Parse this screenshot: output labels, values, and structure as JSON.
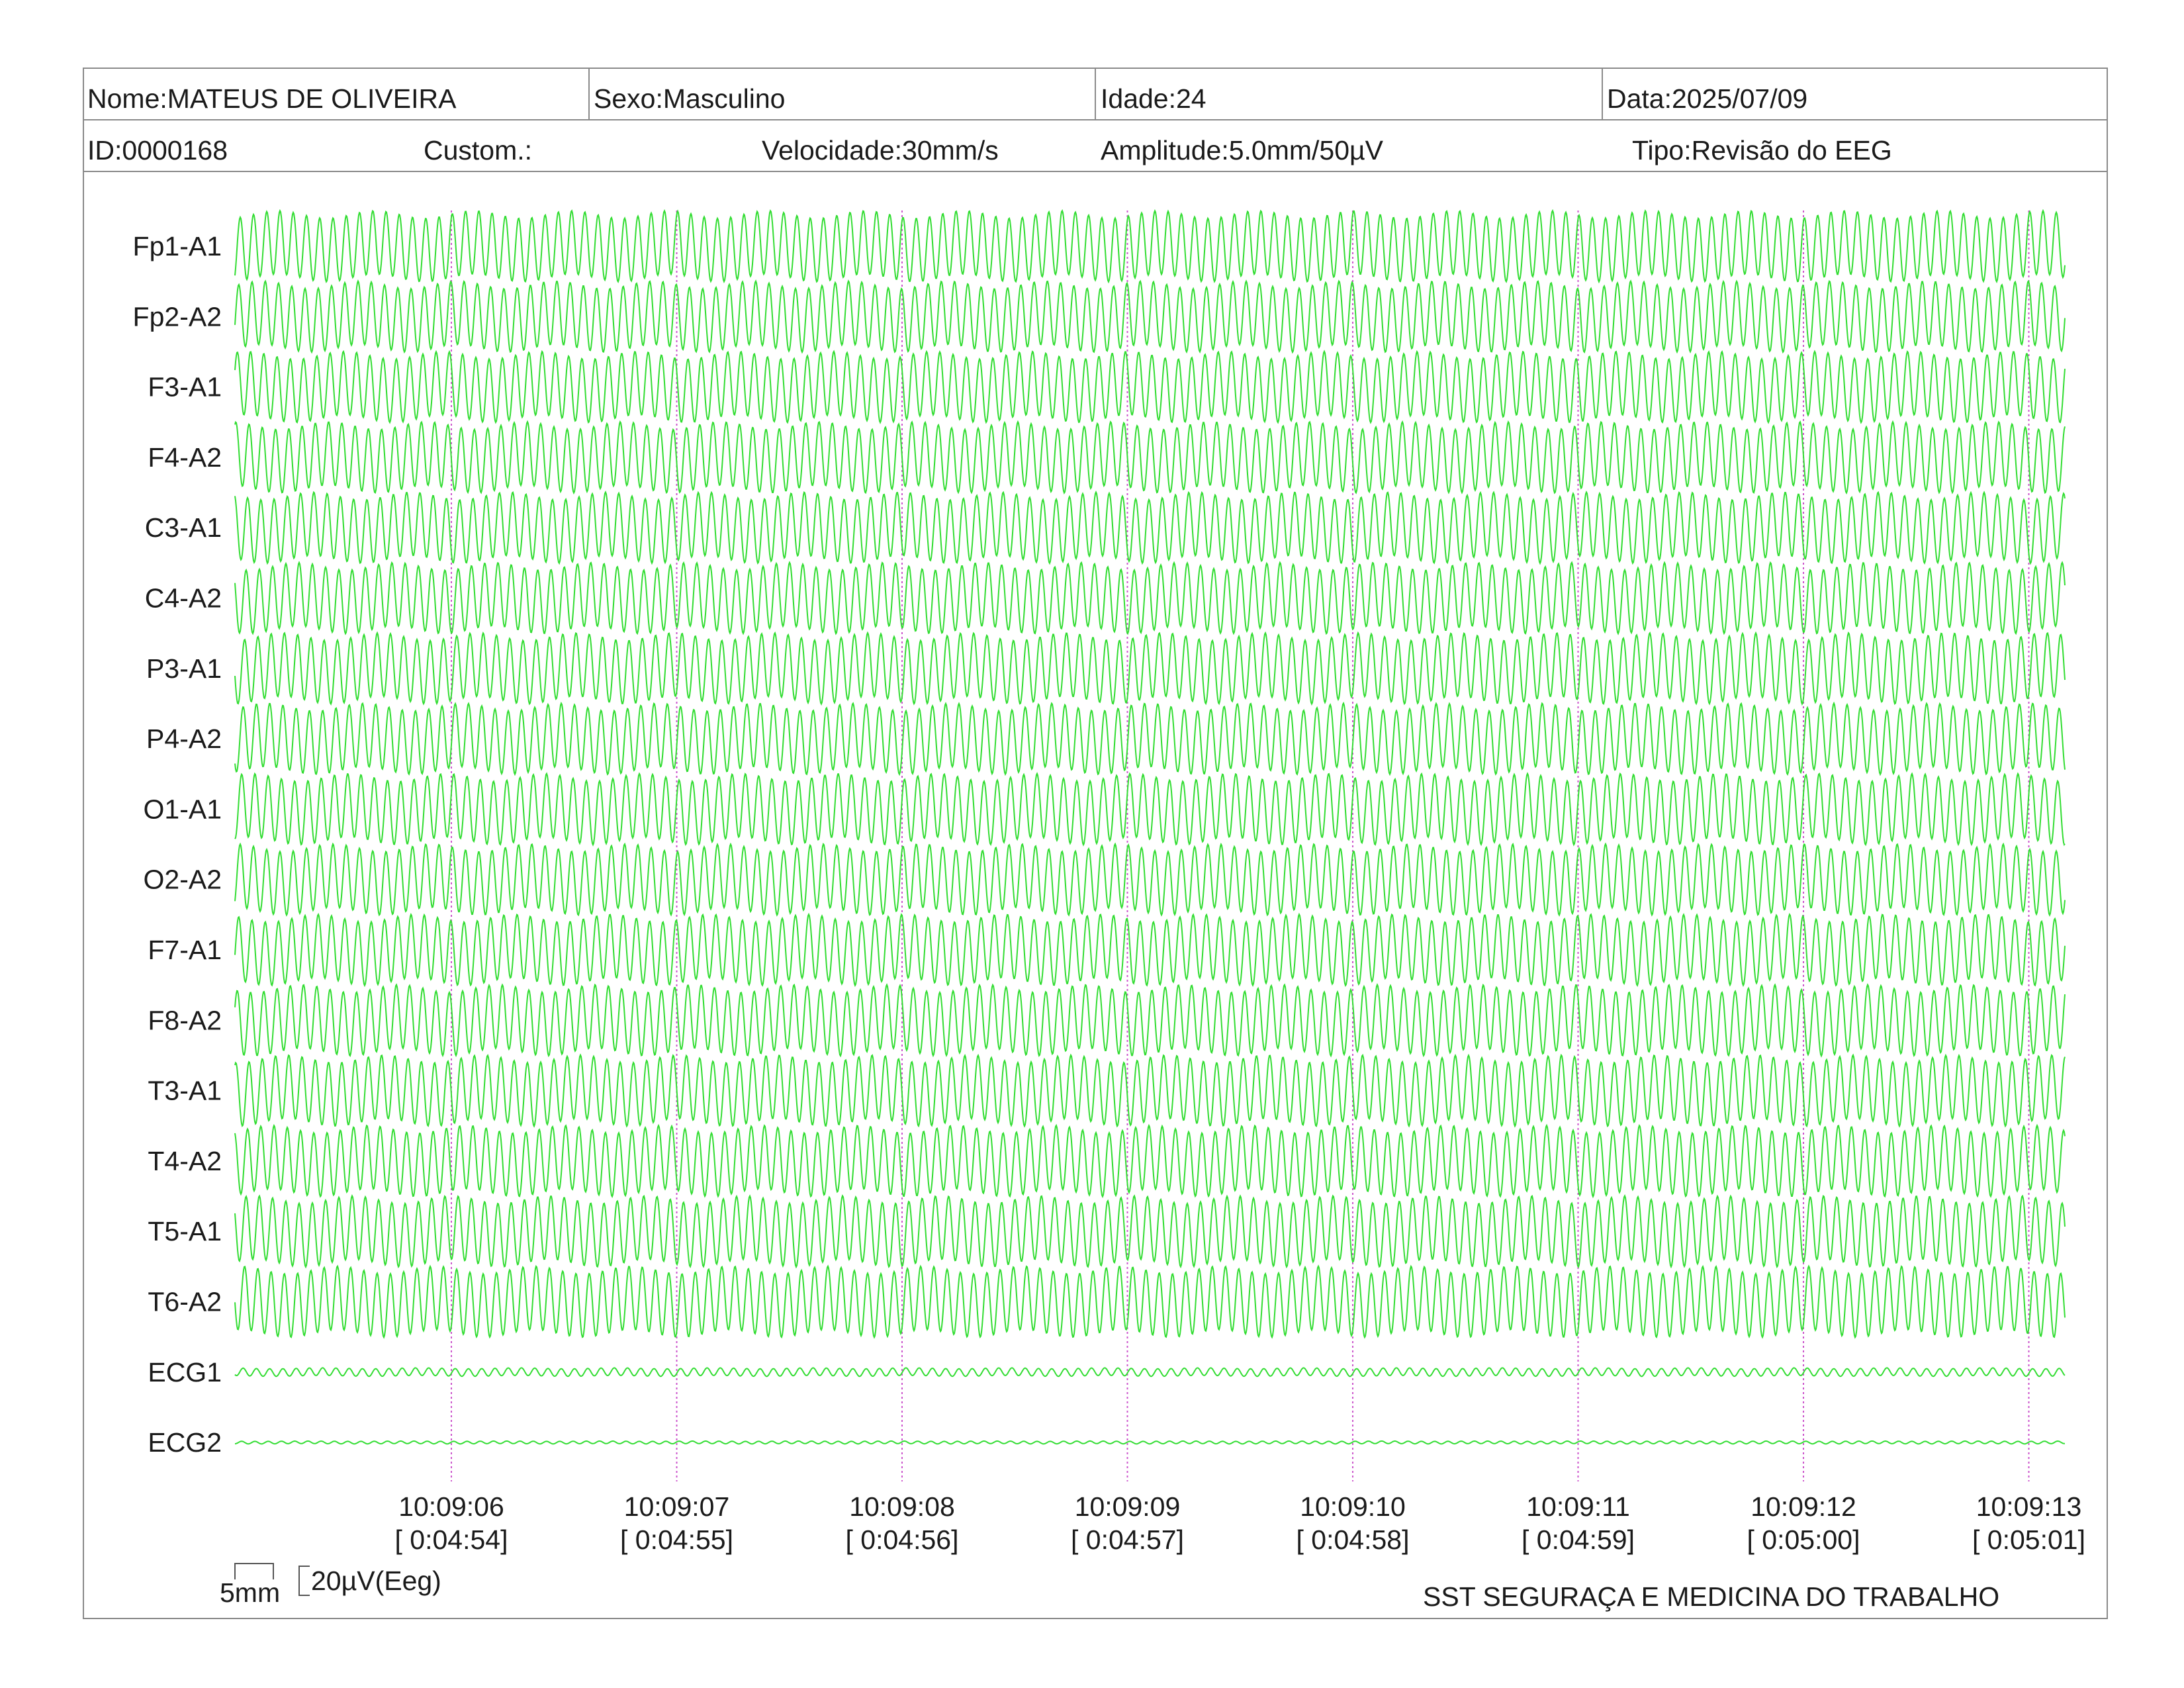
{
  "header": {
    "nome": "Nome:MATEUS DE OLIVEIRA",
    "sexo": "Sexo:Masculino",
    "idade": "Idade:24",
    "data": "Data:2025/07/09",
    "id": "ID:0000168",
    "custom": "Custom.:",
    "velocidade": "Velocidade:30mm/s",
    "amplitude": "Amplitude:5.0mm/50µV",
    "tipo": "Tipo:Revisão do EEG"
  },
  "calibration": {
    "time_label": "5mm",
    "amp_label": "20µV(Eeg)"
  },
  "footer": {
    "org": "SST SEGURAÇA E MEDICINA DO TRABALHO"
  },
  "colors": {
    "trace": "#33dd33",
    "marker": "#cc55cc",
    "border": "#8a8a8a",
    "text": "#1a1a1a"
  },
  "chart_data": {
    "type": "line",
    "title": "",
    "channels": [
      {
        "name": "Fp1-A1",
        "amplitude_rel": 1.0,
        "freq_hz": 17
      },
      {
        "name": "Fp2-A2",
        "amplitude_rel": 1.0,
        "freq_hz": 17
      },
      {
        "name": "F3-A1",
        "amplitude_rel": 1.0,
        "freq_hz": 17
      },
      {
        "name": "F4-A2",
        "amplitude_rel": 1.0,
        "freq_hz": 17
      },
      {
        "name": "C3-A1",
        "amplitude_rel": 1.0,
        "freq_hz": 17
      },
      {
        "name": "C4-A2",
        "amplitude_rel": 1.0,
        "freq_hz": 17
      },
      {
        "name": "P3-A1",
        "amplitude_rel": 1.0,
        "freq_hz": 17
      },
      {
        "name": "P4-A2",
        "amplitude_rel": 1.0,
        "freq_hz": 17
      },
      {
        "name": "O1-A1",
        "amplitude_rel": 1.0,
        "freq_hz": 17
      },
      {
        "name": "O2-A2",
        "amplitude_rel": 1.0,
        "freq_hz": 17
      },
      {
        "name": "F7-A1",
        "amplitude_rel": 1.0,
        "freq_hz": 17
      },
      {
        "name": "F8-A2",
        "amplitude_rel": 1.0,
        "freq_hz": 17
      },
      {
        "name": "T3-A1",
        "amplitude_rel": 1.0,
        "freq_hz": 17
      },
      {
        "name": "T4-A2",
        "amplitude_rel": 1.0,
        "freq_hz": 17
      },
      {
        "name": "T5-A1",
        "amplitude_rel": 1.0,
        "freq_hz": 17
      },
      {
        "name": "T6-A2",
        "amplitude_rel": 1.0,
        "freq_hz": 17
      },
      {
        "name": "ECG1",
        "amplitude_rel": 0.12,
        "freq_hz": 17
      },
      {
        "name": "ECG2",
        "amplitude_rel": 0.04,
        "freq_hz": 17
      }
    ],
    "time_ticks": [
      {
        "clock": "10:09:06",
        "elapsed": "[ 0:04:54]"
      },
      {
        "clock": "10:09:07",
        "elapsed": "[ 0:04:55]"
      },
      {
        "clock": "10:09:08",
        "elapsed": "[ 0:04:56]"
      },
      {
        "clock": "10:09:09",
        "elapsed": "[ 0:04:57]"
      },
      {
        "clock": "10:09:10",
        "elapsed": "[ 0:04:58]"
      },
      {
        "clock": "10:09:11",
        "elapsed": "[ 0:04:59]"
      },
      {
        "clock": "10:09:12",
        "elapsed": "[ 0:05:00]"
      },
      {
        "clock": "10:09:13",
        "elapsed": "[ 0:05:01]"
      }
    ],
    "x_range_s": [
      -0.95,
      7.17
    ],
    "grid": false,
    "legend": "none"
  }
}
